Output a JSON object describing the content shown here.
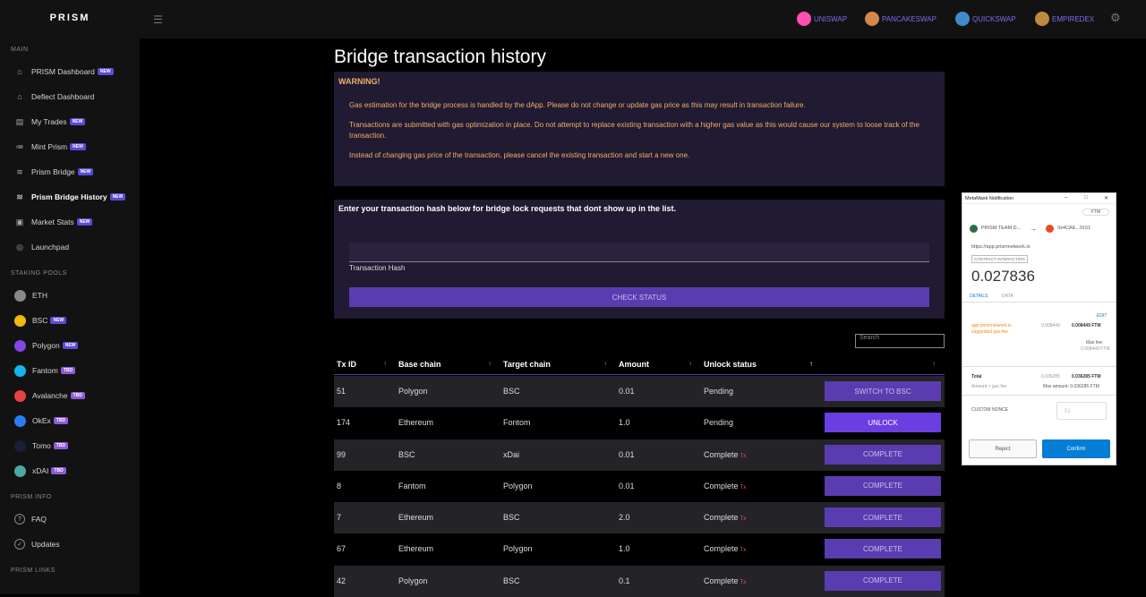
{
  "brand": "PRISM",
  "sidebar": {
    "main_section": "MAIN",
    "main_items": [
      {
        "label": "PRISM Dashboard",
        "badge": "NEW",
        "icon": "home-icon"
      },
      {
        "label": "Deflect Dashboard",
        "badge": "",
        "icon": "home-icon"
      },
      {
        "label": "My Trades",
        "badge": "NEW",
        "icon": "document-icon"
      },
      {
        "label": "Mint Prism",
        "badge": "NEW",
        "icon": "mint-icon"
      },
      {
        "label": "Prism Bridge",
        "badge": "NEW",
        "icon": "bridge-icon"
      },
      {
        "label": "Prism Bridge History",
        "badge": "NEW",
        "icon": "history-icon"
      },
      {
        "label": "Market Stats",
        "badge": "NEW",
        "icon": "stats-icon"
      },
      {
        "label": "Launchpad",
        "badge": "",
        "icon": "launchpad-icon"
      }
    ],
    "staking_section": "STAKING POOLS",
    "staking_items": [
      {
        "label": "ETH",
        "badge": "",
        "color": "#888888"
      },
      {
        "label": "BSC",
        "badge": "NEW",
        "color": "#f0b90b"
      },
      {
        "label": "Polygon",
        "badge": "NEW",
        "color": "#8247e5"
      },
      {
        "label": "Fantom",
        "badge": "TBD",
        "color": "#13b5ec"
      },
      {
        "label": "Avalanche",
        "badge": "TBD",
        "color": "#e84142"
      },
      {
        "label": "OkEx",
        "badge": "TBD",
        "color": "#2a7cf6"
      },
      {
        "label": "Tomo",
        "badge": "TBD",
        "color": "#1a1f36"
      },
      {
        "label": "xDAI",
        "badge": "TBD",
        "color": "#48a9a6"
      }
    ],
    "info_section": "PRISM INFO",
    "info_items": [
      {
        "label": "FAQ",
        "icon": "help-icon"
      },
      {
        "label": "Updates",
        "icon": "check-circle-icon"
      }
    ],
    "links_section": "PRISM LINKS"
  },
  "topbar": {
    "dexes": [
      {
        "label": "UNISWAP",
        "color": "#ff4fb0"
      },
      {
        "label": "PANCAKESWAP",
        "color": "#d1884f"
      },
      {
        "label": "QUICKSWAP",
        "color": "#418aca"
      },
      {
        "label": "EMPIREDEX",
        "color": "#c08a3e"
      }
    ]
  },
  "page": {
    "title": "Bridge transaction history",
    "warning_title": "WARNING!",
    "warning_1": "Gas estimation for the bridge process is handled by the dApp. Please do not change or update gas price as this may result in transaction failure.",
    "warning_2": "Transactions are submitted with gas optimization in place. Do not attempt to replace existing transaction with a higher gas value as this would cause our system to loose track of the transaction.",
    "warning_3": "Instead of changing gas price of the transaction, please cancel the existing transaction and start a new one.",
    "lock_title": "Enter your transaction hash below for bridge lock requests that dont show up in the list.",
    "hash_value": "",
    "hash_label": "Transaction Hash",
    "check_button": "CHECK STATUS",
    "search_placeholder": "Search"
  },
  "table": {
    "headers": [
      "Tx ID",
      "Base chain",
      "Target chain",
      "Amount",
      "Unlock status"
    ],
    "rows": [
      {
        "id": "51",
        "base": "Polygon",
        "target": "BSC",
        "amount": "0.01",
        "status": "Pending",
        "action": "SWITCH TO BSC",
        "link": ""
      },
      {
        "id": "174",
        "base": "Ethereum",
        "target": "Fontom",
        "amount": "1.0",
        "status": "Pending",
        "action": "UNLOCK",
        "link": ""
      },
      {
        "id": "99",
        "base": "BSC",
        "target": "xDai",
        "amount": "0.01",
        "status": "Complete",
        "action": "COMPLETE",
        "link": "Tx"
      },
      {
        "id": "8",
        "base": "Fantom",
        "target": "Polygon",
        "amount": "0.01",
        "status": "Complete",
        "action": "COMPLETE",
        "link": "Tx"
      },
      {
        "id": "7",
        "base": "Ethereum",
        "target": "BSC",
        "amount": "2.0",
        "status": "Complete",
        "action": "COMPLETE",
        "link": "Tx"
      },
      {
        "id": "67",
        "base": "Ethereum",
        "target": "Polygon",
        "amount": "1.0",
        "status": "Complete",
        "action": "COMPLETE",
        "link": "Tx"
      },
      {
        "id": "42",
        "base": "Polygon",
        "target": "BSC",
        "amount": "0.1",
        "status": "Complete",
        "action": "COMPLETE",
        "link": "Tx"
      }
    ]
  },
  "metamask": {
    "title": "MetaMask Notification",
    "network": "FTM",
    "from": "PRISM TEAM D...",
    "to": "0x4CAE...9151",
    "url": "https://app.prismnetwork.io",
    "tag": "CONTRACT INTERACTION",
    "amount": "0.027836",
    "tab_details": "DETAILS",
    "tab_data": "DATA",
    "edit": "EDIT",
    "gas_source": "app.prismnetwork.io",
    "gas_suggested": "suggested gas fee",
    "gas_small": "0.008449",
    "gas_big": "0.008449 FTM",
    "max_fee_label": "Max fee:",
    "max_fee": "0.008449 FTM",
    "total_label": "Total",
    "total_sub": "Amount + gas fee",
    "total_small": "0.036285",
    "total_big": "0.036285 FTM",
    "max_amount": "Max amount: 0.036285 FTM",
    "nonce_label": "CUSTOM NONCE",
    "nonce_placeholder": "51",
    "reject": "Reject",
    "confirm": "Confirm"
  }
}
